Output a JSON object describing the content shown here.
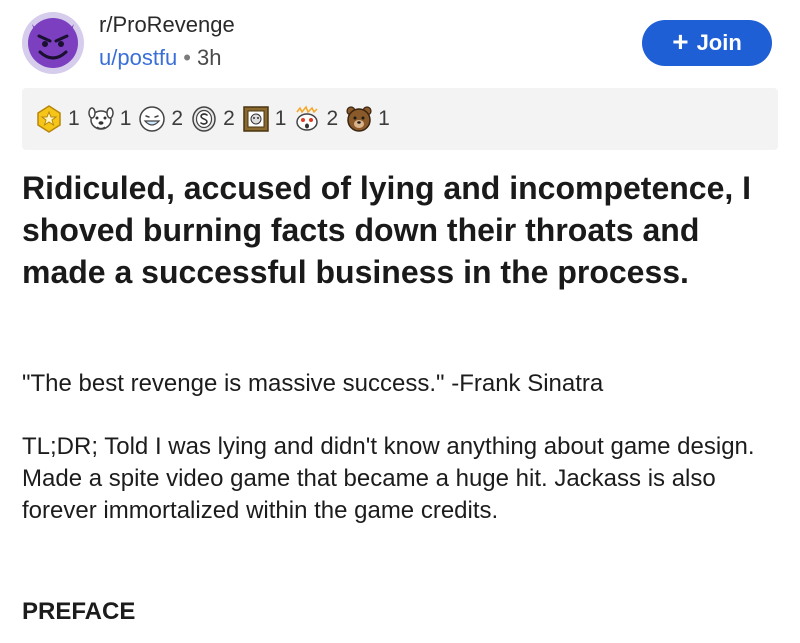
{
  "post": {
    "subreddit": "r/ProRevenge",
    "author": "u/postfu",
    "separator": "•",
    "age": "3h",
    "join_label": "Join",
    "join_icon": "plus-icon",
    "avatar_icon": "devil-face-icon"
  },
  "awards": [
    {
      "icon": "star-award-icon",
      "count": "1"
    },
    {
      "icon": "dog-face-award-icon",
      "count": "1"
    },
    {
      "icon": "laughing-face-award-icon",
      "count": "2"
    },
    {
      "icon": "coin-award-icon",
      "count": "2"
    },
    {
      "icon": "framed-picture-award-icon",
      "count": "1"
    },
    {
      "icon": "shocked-snoo-award-icon",
      "count": "2"
    },
    {
      "icon": "bear-award-icon",
      "count": "1"
    }
  ],
  "content": {
    "title": "Ridiculed, accused of lying and incompetence, I shoved burning facts down their throats and made a successful business in the process.",
    "quote": "\"The best revenge is massive success.\" -Frank Sinatra",
    "tldr": "TL;DR; Told I was lying and didn't know anything about game design. Made a spite video game that became a huge hit. Jackass is also forever immortalized within the game credits.",
    "section_heading": "PREFACE"
  },
  "colors": {
    "accent": "#1f5fd6",
    "link": "#3a6fd8",
    "avatar_bg": "#d6ccec",
    "devil": "#7b3fbf",
    "award_bar": "#f3f3f4"
  }
}
